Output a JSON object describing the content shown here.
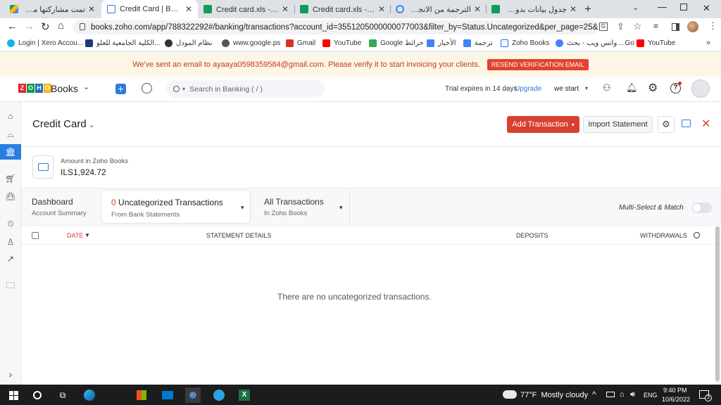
{
  "tabs": [
    {
      "title": "تمت مشاركتها معي - ...",
      "icon": "google-drive-icon",
      "active": false
    },
    {
      "title": "Credit Card | Banking",
      "icon": "zoho-books-icon",
      "active": true
    },
    {
      "title": "Credit card.xls - بيانات",
      "icon": "google-sheets-icon",
      "active": false
    },
    {
      "title": "Credit card.xls - بيانات",
      "icon": "google-sheets-icon",
      "active": false
    },
    {
      "title": "الترجمة من الانجليزية ال...",
      "icon": "google-icon",
      "active": false
    },
    {
      "title": "جدول بيانات بدون عنوان",
      "icon": "google-sheets-icon",
      "active": false
    }
  ],
  "new_tab_label": "+",
  "url": "books.zoho.com/app/788322292#/banking/transactions?account_id=3551205000000077003&filter_by=Status.Uncategorized&per_page=25&sort_order...",
  "bookmarks": [
    {
      "label": "Login | Xero Accou...",
      "icon": "xero-icon",
      "color": "#13b5ea"
    },
    {
      "label": "الكلية الجامعية للعلو...",
      "icon": "college-icon",
      "color": "#1a3d7a"
    },
    {
      "label": "نظام المودل",
      "icon": "moodle-icon",
      "color": "#333"
    },
    {
      "label": "www.google.ps",
      "icon": "globe-icon",
      "color": "#555"
    },
    {
      "label": "Gmail",
      "icon": "gmail-icon",
      "color": "#d93025"
    },
    {
      "label": "YouTube",
      "icon": "youtube-icon",
      "color": "#ff0000"
    },
    {
      "label": "Google خرائط",
      "icon": "maps-icon",
      "color": "#34a853"
    },
    {
      "label": "الأخبار",
      "icon": "news-icon",
      "color": "#4285f4"
    },
    {
      "label": "ترجمة",
      "icon": "translate-icon",
      "color": "#4285f4"
    },
    {
      "label": "Zoho Books",
      "icon": "zoho-books-icon",
      "color": "#1a73e8"
    },
    {
      "label": "واتس ويب - بحث ...Go",
      "icon": "google-icon",
      "color": "#4285f4"
    },
    {
      "label": "YouTube",
      "icon": "youtube-icon",
      "color": "#ff0000"
    }
  ],
  "banner": {
    "message": "We've sent an email to ayaaya0598359584@gmail.com. Please verify it to start invoicing your clients.",
    "resend_label": "RESEND VERIFICATION EMAIL"
  },
  "app_header": {
    "logo_text": "Books",
    "search_placeholder": "Search in Banking ( / )",
    "trial_text": "Trial expires in 14 days",
    "upgrade_label": "Upgrade",
    "org_name": "we start"
  },
  "account": {
    "name": "Credit Card",
    "add_transaction_label": "Add Transaction",
    "import_statement_label": "Import Statement",
    "amount_label": "Amount in Zoho Books",
    "amount_value": "ILS1,924.72"
  },
  "view_tabs": {
    "dashboard_title": "Dashboard",
    "dashboard_sub": "Account Summary",
    "uncat_count": "0",
    "uncat_title": "Uncategorized Transactions",
    "uncat_sub": "From Bank Statements",
    "all_title": "All Transactions",
    "all_sub": "In Zoho Books",
    "multi_select_label": "Multi-Select & Match"
  },
  "table": {
    "columns": {
      "date": "DATE",
      "details": "STATEMENT DETAILS",
      "deposits": "DEPOSITS",
      "withdrawals": "WITHDRAWALS"
    },
    "empty_message": "There are no uncategorized transactions."
  },
  "taskbar": {
    "weather": "77°F  Mostly cloudy",
    "language": "ENG",
    "time": "9:40 PM",
    "date": "10/6/2022",
    "notification_count": "3"
  }
}
